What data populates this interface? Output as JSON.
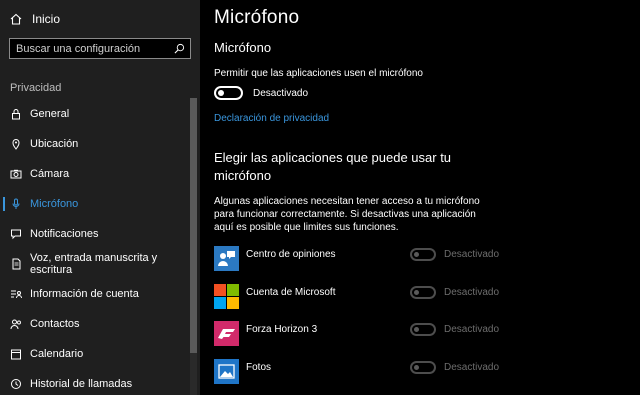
{
  "sidebar": {
    "home_label": "Inicio",
    "search_placeholder": "Buscar una configuración",
    "section_label": "Privacidad",
    "items": [
      {
        "label": "General",
        "icon": "lock-icon"
      },
      {
        "label": "Ubicación",
        "icon": "location-icon"
      },
      {
        "label": "Cámara",
        "icon": "camera-icon"
      },
      {
        "label": "Micrófono",
        "icon": "microphone-icon",
        "active": true
      },
      {
        "label": "Notificaciones",
        "icon": "notification-icon"
      },
      {
        "label": "Voz, entrada manuscrita y escritura",
        "icon": "handwriting-icon"
      },
      {
        "label": "Información de cuenta",
        "icon": "account-info-icon"
      },
      {
        "label": "Contactos",
        "icon": "contacts-icon"
      },
      {
        "label": "Calendario",
        "icon": "calendar-icon"
      },
      {
        "label": "Historial de llamadas",
        "icon": "history-icon"
      }
    ]
  },
  "main": {
    "page_title": "Micrófono",
    "sub_title": "Micrófono",
    "permission_label": "Permitir que las aplicaciones usen el micrófono",
    "toggle_state": "Desactivado",
    "privacy_link": "Declaración de privacidad",
    "section_title": "Elegir las aplicaciones que puede usar tu micrófono",
    "description": "Algunas aplicaciones necesitan tener acceso a tu micrófono para funcionar correctamente. Si desactivas una aplicación aquí es posible que limites sus funciones.",
    "apps": [
      {
        "name": "Centro de opiniones",
        "state": "Desactivado",
        "icon": "feedback-hub-icon"
      },
      {
        "name": "Cuenta de Microsoft",
        "state": "Desactivado",
        "icon": "microsoft-logo-icon"
      },
      {
        "name": "Forza Horizon 3",
        "state": "Desactivado",
        "icon": "forza-icon"
      },
      {
        "name": "Fotos",
        "state": "Desactivado",
        "icon": "photos-icon"
      }
    ]
  },
  "colors": {
    "accent": "#3a96dd",
    "sidebar_bg": "#1f1f1f",
    "main_bg": "#000000"
  }
}
